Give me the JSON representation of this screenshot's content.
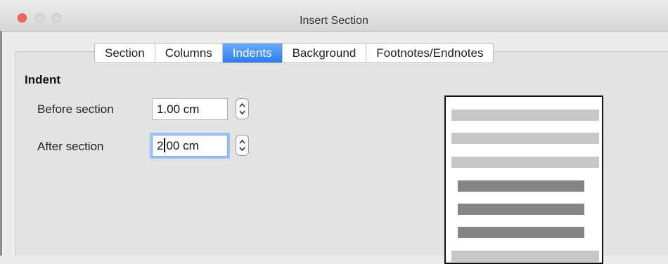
{
  "window": {
    "title": "Insert Section"
  },
  "tabs": [
    {
      "label": "Section",
      "active": false
    },
    {
      "label": "Columns",
      "active": false
    },
    {
      "label": "Indents",
      "active": true
    },
    {
      "label": "Background",
      "active": false
    },
    {
      "label": "Footnotes/Endnotes",
      "active": false
    }
  ],
  "indent": {
    "heading": "Indent",
    "before": {
      "label": "Before section",
      "value": "1.00 cm"
    },
    "after": {
      "label": "After section",
      "value_before_caret": "2",
      "value_after_caret": "00 cm"
    }
  },
  "colors": {
    "accent": "#2a7cf4",
    "close": "#fc615d"
  }
}
